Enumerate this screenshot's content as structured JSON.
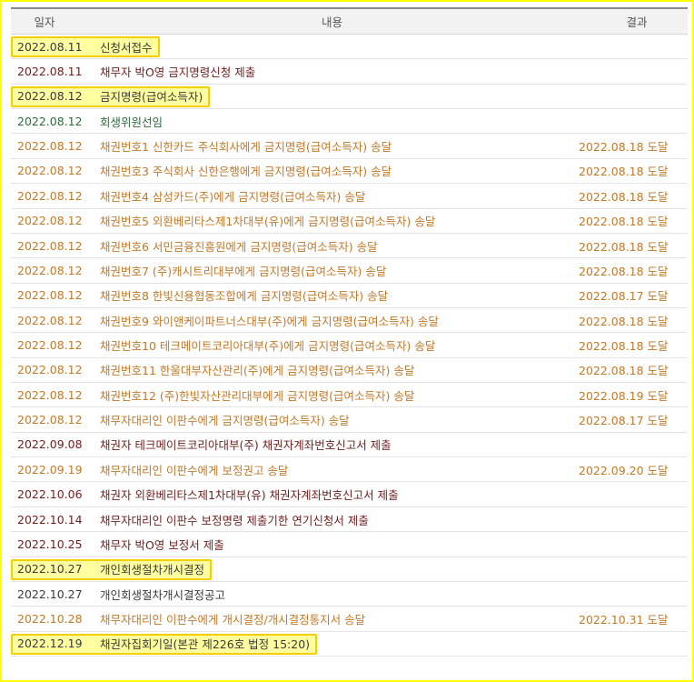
{
  "header": {
    "date": "일자",
    "content": "내용",
    "result": "결과"
  },
  "colors": {
    "highlight": "#ffff66",
    "frame": "#ffff00",
    "orange": "#c07a2a",
    "maroon": "#6e1f1f",
    "dark": "#3a3a3a",
    "green": "#2e6b3e"
  },
  "rows": [
    {
      "date": "2022.08.11",
      "content": "신청서접수",
      "result": "",
      "color": "dark",
      "highlight": true
    },
    {
      "date": "2022.08.11",
      "content": "채무자 박O영 금지명령신청 제출",
      "result": "",
      "color": "maroon",
      "highlight": false
    },
    {
      "date": "2022.08.12",
      "content": "금지명령(급여소득자)",
      "result": "",
      "color": "dark",
      "highlight": true
    },
    {
      "date": "2022.08.12",
      "content": "회생위원선임",
      "result": "",
      "color": "green",
      "highlight": false
    },
    {
      "date": "2022.08.12",
      "content": "채권번호1 신한카드 주식회사에게 금지명령(급여소득자) 송달",
      "result": "2022.08.18 도달",
      "color": "orange",
      "highlight": false
    },
    {
      "date": "2022.08.12",
      "content": "채권번호3 주식회사 신한은행에게 금지명령(급여소득자) 송달",
      "result": "2022.08.18 도달",
      "color": "orange",
      "highlight": false
    },
    {
      "date": "2022.08.12",
      "content": "채권번호4 삼성카드(주)에게 금지명령(급여소득자) 송달",
      "result": "2022.08.18 도달",
      "color": "orange",
      "highlight": false
    },
    {
      "date": "2022.08.12",
      "content": "채권번호5 외환베리타스제1차대부(유)에게 금지명령(급여소득자) 송달",
      "result": "2022.08.18 도달",
      "color": "orange",
      "highlight": false
    },
    {
      "date": "2022.08.12",
      "content": "채권번호6 서민금융진흥원에게 금지명령(급여소득자) 송달",
      "result": "2022.08.18 도달",
      "color": "orange",
      "highlight": false
    },
    {
      "date": "2022.08.12",
      "content": "채권번호7 (주)캐시트리대부에게 금지명령(급여소득자) 송달",
      "result": "2022.08.18 도달",
      "color": "orange",
      "highlight": false
    },
    {
      "date": "2022.08.12",
      "content": "채권번호8 한빛신용협동조합에게 금지명령(급여소득자) 송달",
      "result": "2022.08.17 도달",
      "color": "orange",
      "highlight": false
    },
    {
      "date": "2022.08.12",
      "content": "채권번호9 와이앤케이파트너스대부(주)에게 금지명령(급여소득자) 송달",
      "result": "2022.08.18 도달",
      "color": "orange",
      "highlight": false
    },
    {
      "date": "2022.08.12",
      "content": "채권번호10 테크메이트코리아대부(주)에게 금지명령(급여소득자) 송달",
      "result": "2022.08.18 도달",
      "color": "orange",
      "highlight": false
    },
    {
      "date": "2022.08.12",
      "content": "채권번호11 한울대부자산관리(주)에게 금지명령(급여소득자) 송달",
      "result": "2022.08.18 도달",
      "color": "orange",
      "highlight": false
    },
    {
      "date": "2022.08.12",
      "content": "채권번호12 (주)한빛자산관리대부에게 금지명령(급여소득자) 송달",
      "result": "2022.08.19 도달",
      "color": "orange",
      "highlight": false
    },
    {
      "date": "2022.08.12",
      "content": "채무자대리인 이판수에게 금지명령(급여소득자) 송달",
      "result": "2022.08.17 도달",
      "color": "orange",
      "highlight": false
    },
    {
      "date": "2022.09.08",
      "content": "채권자 테크메이트코리아대부(주) 채권자계좌번호신고서 제출",
      "result": "",
      "color": "maroon",
      "highlight": false
    },
    {
      "date": "2022.09.19",
      "content": "채무자대리인 이판수에게 보정권고 송달",
      "result": "2022.09.20 도달",
      "color": "orange",
      "highlight": false
    },
    {
      "date": "2022.10.06",
      "content": "채권자 외환베리타스제1차대부(유) 채권자계좌번호신고서 제출",
      "result": "",
      "color": "maroon",
      "highlight": false
    },
    {
      "date": "2022.10.14",
      "content": "채무자대리인 이판수 보정명령 제출기한 연기신청서 제출",
      "result": "",
      "color": "maroon",
      "highlight": false
    },
    {
      "date": "2022.10.25",
      "content": "채무자 박O영 보정서 제출",
      "result": "",
      "color": "maroon",
      "highlight": false
    },
    {
      "date": "2022.10.27",
      "content": "개인회생절차개시결정",
      "result": "",
      "color": "dark",
      "highlight": true
    },
    {
      "date": "2022.10.27",
      "content": "개인회생절차개시결정공고",
      "result": "",
      "color": "dark",
      "highlight": false
    },
    {
      "date": "2022.10.28",
      "content": "채무자대리인 이판수에게 개시결정/개시결정통지서 송달",
      "result": "2022.10.31 도달",
      "color": "orange",
      "highlight": false
    },
    {
      "date": "2022.12.19",
      "content": "채권자집회기일(본관 제226호 법정 15:20)",
      "result": "",
      "color": "dark",
      "highlight": true
    }
  ]
}
